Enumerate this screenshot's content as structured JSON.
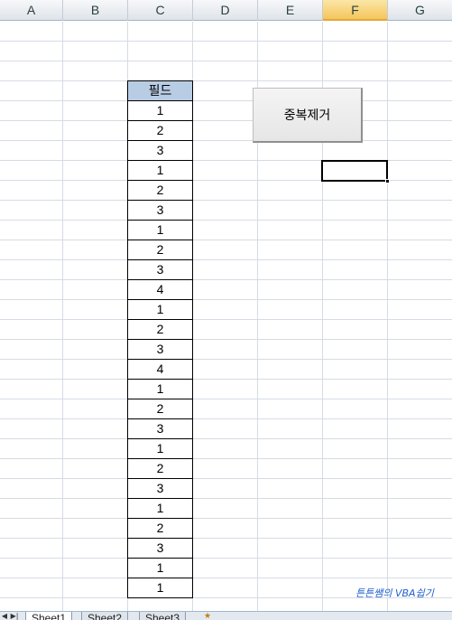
{
  "columns": [
    "A",
    "B",
    "C",
    "D",
    "E",
    "F",
    "G"
  ],
  "active_column": "F",
  "data_header": "필드",
  "data_values": [
    "1",
    "2",
    "3",
    "1",
    "2",
    "3",
    "1",
    "2",
    "3",
    "4",
    "1",
    "2",
    "3",
    "4",
    "1",
    "2",
    "3",
    "1",
    "2",
    "3",
    "1",
    "2",
    "3",
    "1",
    "1"
  ],
  "button_label": "중복제거",
  "watermark": "튼튼쌤의 VBA쉽기",
  "sheets": [
    "Sheet1",
    "Sheet2",
    "Sheet3"
  ],
  "active_sheet": "Sheet1",
  "icons": {
    "nav_prev": "triangle-left-icon",
    "nav_last": "triangle-right-bar-icon",
    "add_sheet": "new-sheet-icon"
  }
}
